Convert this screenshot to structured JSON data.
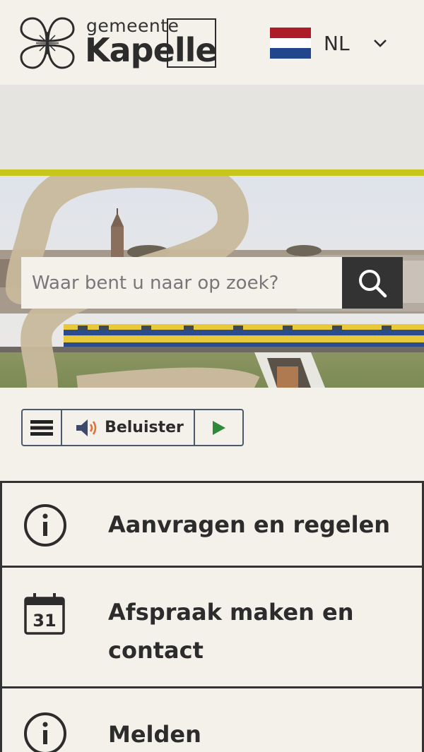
{
  "header": {
    "logo_small": "gemeente",
    "logo_big": "Kapelle",
    "language_code": "NL",
    "flag_colors": [
      "#ae1c28",
      "#ffffff",
      "#21468b"
    ]
  },
  "search": {
    "placeholder": "Waar bent u naar op zoek?"
  },
  "readspeaker": {
    "label": "Beluister"
  },
  "tiles": [
    {
      "label": "Aanvragen en regelen",
      "icon": "info-icon"
    },
    {
      "label": "Afspraak maken en contact",
      "icon": "calendar-icon",
      "calendar_day": "31"
    },
    {
      "label": "Melden",
      "icon": "info-icon"
    }
  ],
  "colors": {
    "accent": "#c6c61c",
    "dark": "#333333",
    "background": "#f4f1ea"
  }
}
